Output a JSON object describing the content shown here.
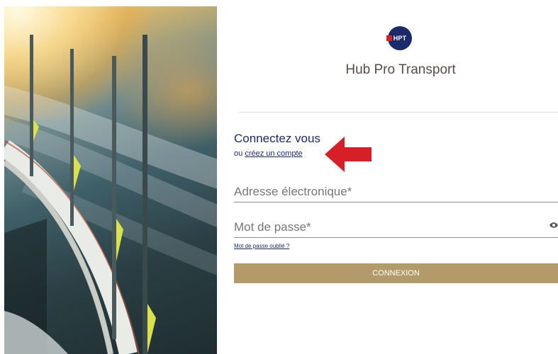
{
  "brand": {
    "logo_text": "HPT",
    "app_title": "Hub Pro Transport",
    "accent_color": "#1b2a6b",
    "flag_color": "#d61f26"
  },
  "login": {
    "heading": "Connectez vous",
    "create_prefix": "ou",
    "create_link": "créez un compte",
    "email_placeholder": "Adresse électronique*",
    "password_placeholder": "Mot de passe*",
    "forgot_link": "Mot de passe oublié ?",
    "submit_label": "CONNEXION",
    "button_color": "#b39a6a"
  },
  "annotation": {
    "arrow_color": "#d61f26",
    "arrow_icon": "left-arrow-icon"
  },
  "icons": {
    "password_toggle": "eye-icon"
  }
}
